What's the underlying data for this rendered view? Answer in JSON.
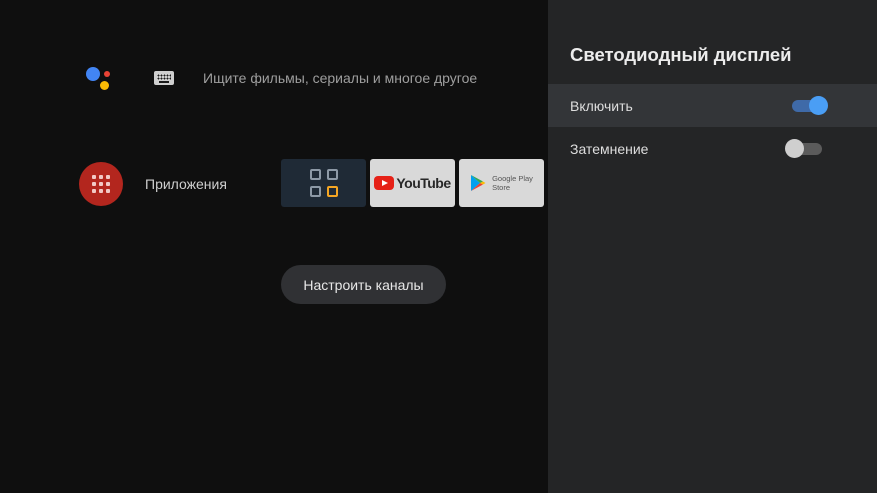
{
  "home": {
    "search_placeholder": "Ищите фильмы, сериалы и многое другое",
    "apps_label": "Приложения",
    "tiles": [
      {
        "name": "launcher"
      },
      {
        "name": "YouTube",
        "label": "YouTube"
      },
      {
        "name": "Google Play Store",
        "line1": "Google Play",
        "line2": "Store"
      }
    ],
    "configure_channels_label": "Настроить каналы"
  },
  "panel": {
    "title": "Светодиодный дисплей",
    "items": [
      {
        "label": "Включить",
        "toggle": true,
        "selected": true
      },
      {
        "label": "Затемнение",
        "toggle": false,
        "selected": false
      }
    ]
  },
  "colors": {
    "background": "#0f0f0f",
    "panel": "#242526",
    "accent_blue": "#4a9ef5",
    "apps_red": "#b3261e"
  },
  "icons": [
    "google-assistant-icon",
    "keyboard-icon",
    "apps-grid-icon",
    "launcher-grid-icon",
    "youtube-logo-icon",
    "google-play-icon"
  ]
}
